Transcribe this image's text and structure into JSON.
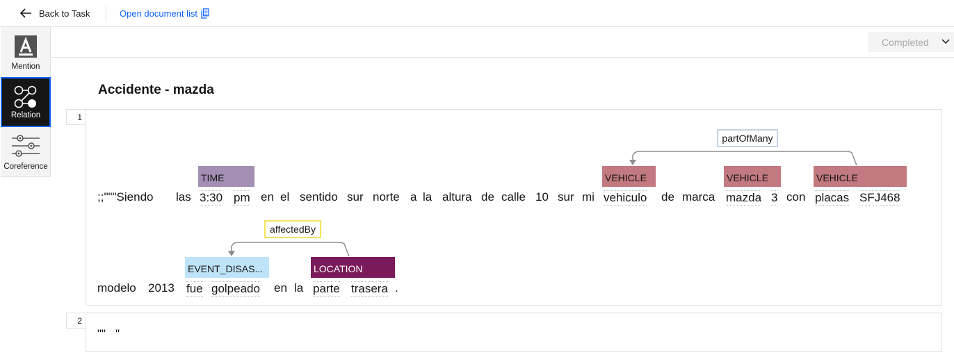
{
  "topbar": {
    "back_label": "Back to Task",
    "doclist_label": "Open document list"
  },
  "tools": [
    {
      "label": "Mention",
      "icon": "mention-icon",
      "active": false
    },
    {
      "label": "Relation",
      "icon": "relation-icon",
      "active": true
    },
    {
      "label": "Coreference",
      "icon": "coreference-icon",
      "active": false
    }
  ],
  "status": {
    "label": "Completed"
  },
  "document": {
    "title": "Accidente - mazda",
    "sentences": [
      {
        "number": "1",
        "line1": [
          ";;\"\"\"Siendo",
          "las",
          "3:30",
          "pm",
          "en",
          "el",
          "sentido",
          "sur",
          "norte",
          "a",
          "la",
          "altura",
          "de",
          "calle",
          "10",
          "sur",
          "mi",
          "vehiculo",
          "de",
          "marca",
          "mazda",
          "3",
          "con",
          "placas",
          "SFJ468"
        ],
        "line2": [
          "modelo",
          "2013",
          "fue",
          "golpeado",
          "en",
          "la",
          "parte",
          "trasera",
          "."
        ],
        "entities": [
          {
            "label": "TIME",
            "text": "3:30 pm",
            "color": "#a38fb3"
          },
          {
            "label": "VEHICLE",
            "text": "vehiculo",
            "color": "#c2797f"
          },
          {
            "label": "VEHICLE",
            "text": "mazda 3",
            "color": "#c2797f"
          },
          {
            "label": "VEHICLE",
            "text": "placas SFJ468",
            "color": "#c2797f"
          },
          {
            "label": "EVENT_DISAS...",
            "text": "fue golpeado",
            "color": "#bfe3f8"
          },
          {
            "label": "LOCATION",
            "text": "parte trasera",
            "color": "#7a1a5b"
          }
        ],
        "relations": [
          {
            "label": "partOfMany",
            "border": "#c4d4e4"
          },
          {
            "label": "affectedBy",
            "border": "#f1e35a"
          }
        ]
      },
      {
        "number": "2",
        "line1": [
          "\"\"",
          "\""
        ]
      }
    ]
  },
  "colors": {
    "accent": "#0f62fe",
    "active_tool_bg": "#161616"
  }
}
